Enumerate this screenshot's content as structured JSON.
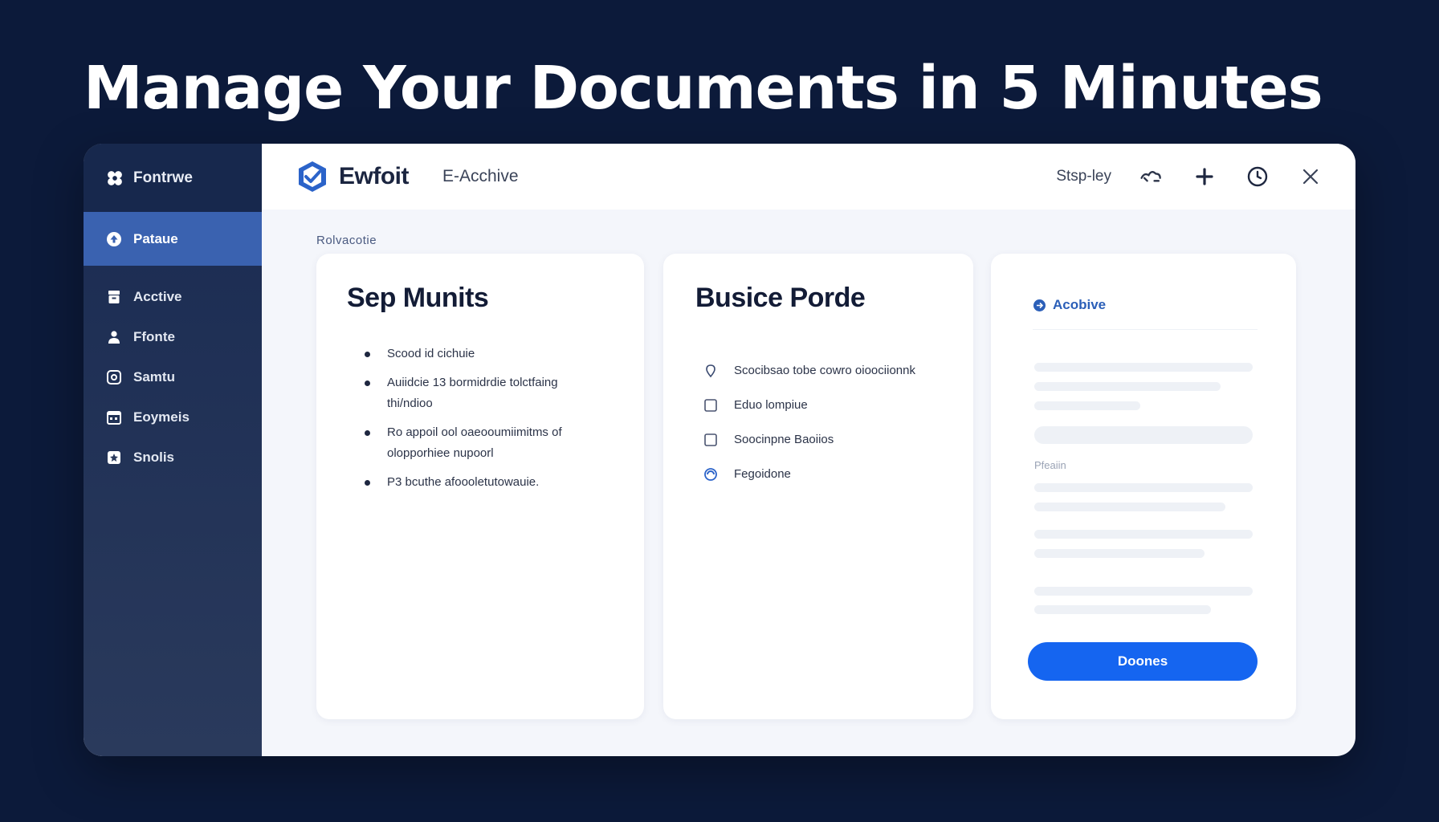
{
  "headline": "Manage Your Documents in 5 Minutes",
  "sidebar": {
    "brand": "Fontrwe",
    "items": [
      {
        "label": "Pataue",
        "icon": "upload-icon",
        "active": true
      },
      {
        "label": "Acctive",
        "icon": "archive-icon",
        "active": false
      },
      {
        "label": "Ffonte",
        "icon": "person-icon",
        "active": false
      },
      {
        "label": "Samtu",
        "icon": "chat-icon",
        "active": false
      },
      {
        "label": "Eoymeis",
        "icon": "calendar-icon",
        "active": false
      },
      {
        "label": "Snolis",
        "icon": "star-icon",
        "active": false
      }
    ]
  },
  "topbar": {
    "logo_text": "Ewfoit",
    "tab_title": "E-Acchive",
    "link": "Stsp-ley",
    "icons": [
      "cloud-icon",
      "plus-icon",
      "clock-icon",
      "close-icon"
    ]
  },
  "breadcrumb": "Rolvacotie",
  "card1": {
    "title": "Sep Munits",
    "bullets": [
      "Scood id cichuie",
      "Auiidcie 13 bormidrdie tolctfaing thi/ndioo",
      "Ro appoil ool oaeooumiimitms of olopporhiee nupoorl",
      "P3 bcuthe afoooletutowauie."
    ]
  },
  "card2": {
    "title": "Busice Porde",
    "items": [
      {
        "label": "Scocibsao tobe cowro oioociionnk",
        "icon": "location-pin-icon"
      },
      {
        "label": "Eduo lompiue",
        "icon": "checkbox-icon"
      },
      {
        "label": "Soocinpne Baoiios",
        "icon": "checkbox-icon"
      },
      {
        "label": "Fegoidone",
        "icon": "radio-icon"
      }
    ]
  },
  "card3": {
    "heading": "Acobive",
    "label": "Pfeaiin",
    "button": "Doones"
  },
  "colors": {
    "background": "#0c1a3a",
    "sidebar_active": "#3a62b0",
    "accent": "#1565f0",
    "logo": "#2b63c9"
  }
}
